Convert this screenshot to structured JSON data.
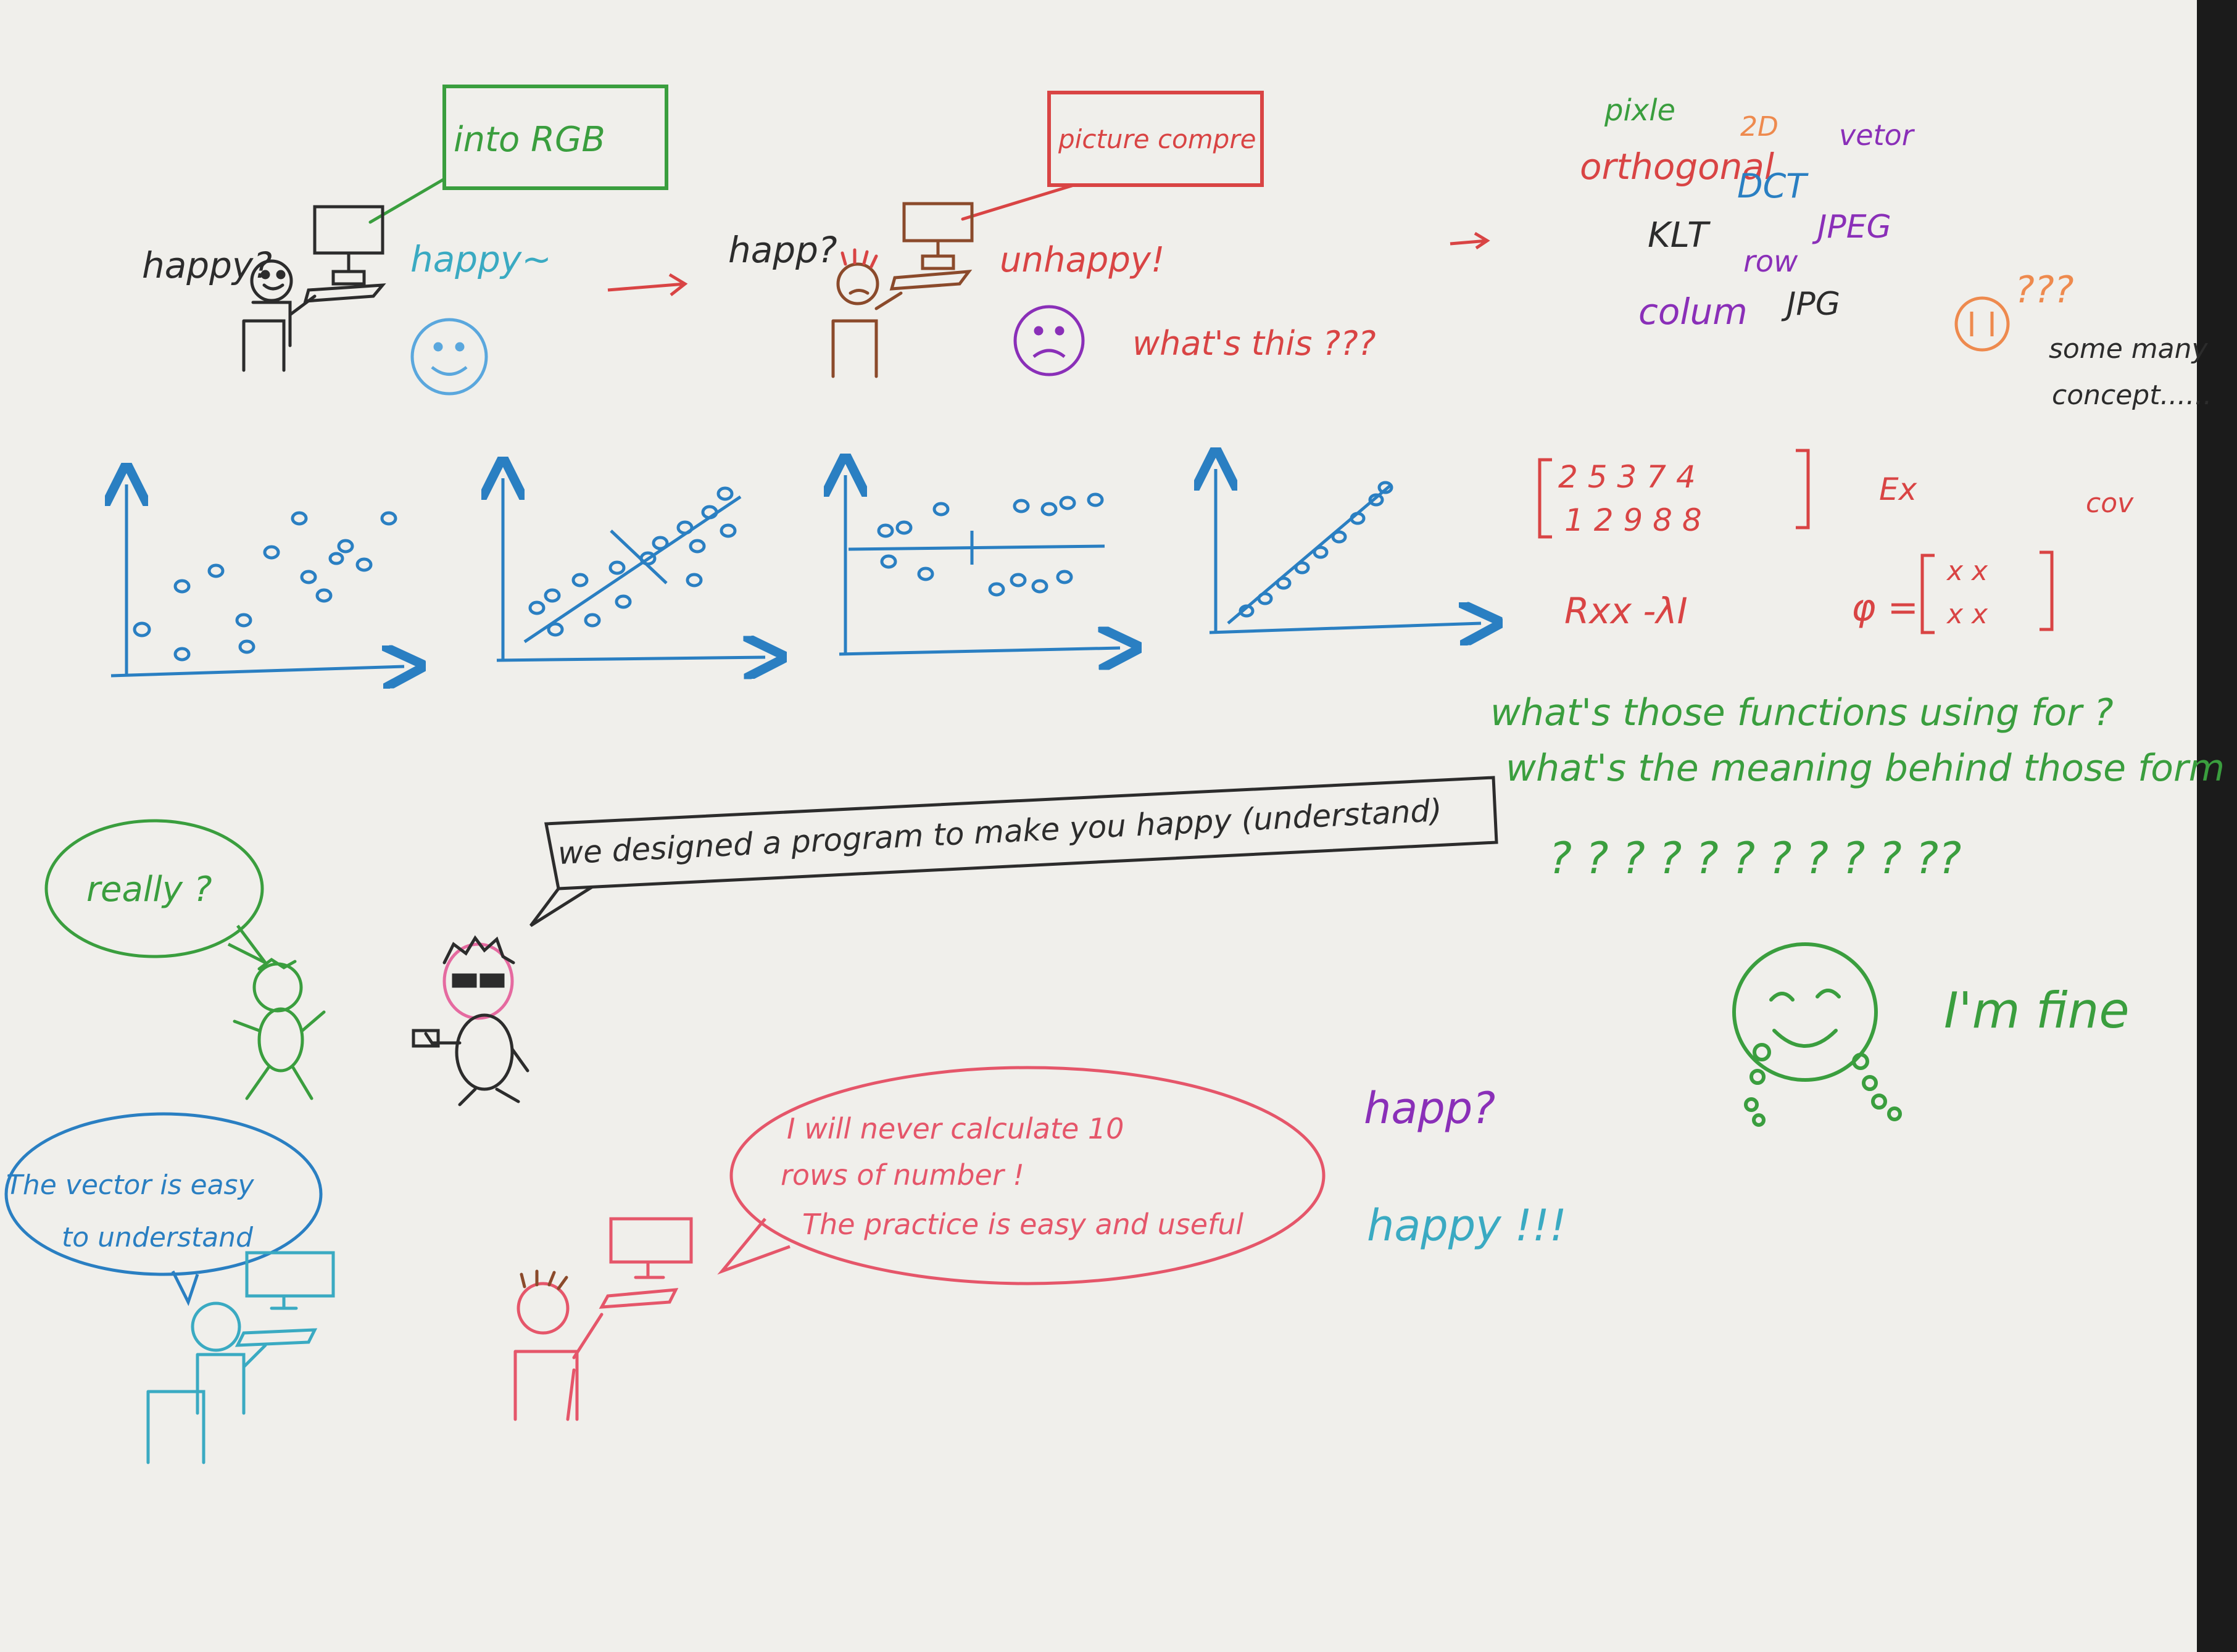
{
  "colors": {
    "paper": "#f0efeb",
    "pencil": "#2c2c2c",
    "green": "#3a9e3e",
    "red": "#d94444",
    "blue": "#2a7fc2",
    "purple": "#8a2fb8",
    "orange": "#ee8a4e",
    "pink": "#e56aa0",
    "teal": "#3aaac2",
    "brown": "#8b4a2b"
  },
  "scene_top": {
    "left": {
      "screen_note": "into RGB",
      "question": "happy?",
      "answer": "happy~"
    },
    "middle": {
      "screen_note": "picture compre",
      "question": "happ?",
      "answer": "unhappy!",
      "what": "what's this ???"
    },
    "concepts": {
      "pixle": "pixle",
      "two_d": "2D",
      "vetor": "vetor",
      "orthogonal": "orthogonal",
      "dct": "DCT",
      "klt": "KLT",
      "jpeg": "JPEG",
      "row": "row",
      "column": "colum",
      "jpg": "JPG",
      "marks": "???",
      "note_line1": "some many",
      "note_line2": "concept......"
    }
  },
  "math": {
    "matrix_row1": "2 5 3 7 4",
    "matrix_row2": "1 2 9 8 8",
    "ex": "Ex",
    "cov": "cov",
    "rxx": "Rxx -λI",
    "phi": "φ =",
    "phi_matrix_row1": "x  x",
    "phi_matrix_row2": "x  x"
  },
  "questions": {
    "line1": "what's those functions using for ?",
    "line2": "what's the meaning behind those form",
    "marks": "? ? ? ? ? ? ? ? ? ? ??"
  },
  "scene_bottom": {
    "program_sign": "we designed a program to make you happy (understand)",
    "really": "really ?",
    "vector_bubble_line1": "The vector is easy",
    "vector_bubble_line2": "to understand",
    "calc_bubble_line1": "I will never calculate 10",
    "calc_bubble_line2": "rows of number !",
    "calc_bubble_line3": "The practice is easy and useful",
    "happ": "happ?",
    "happy": "happy !!!",
    "fine": "I'm fine"
  }
}
